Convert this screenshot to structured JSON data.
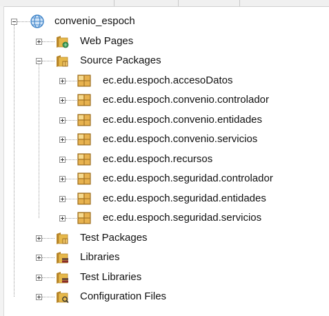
{
  "project": {
    "name": "convenio_espoch",
    "expanded": true
  },
  "nodes": [
    {
      "label": "Web Pages",
      "icon": "web-pages-folder-icon",
      "expanded": false
    },
    {
      "label": "Source Packages",
      "icon": "source-packages-folder-icon",
      "expanded": true,
      "children": [
        {
          "label": "ec.edu.espoch.accesoDatos",
          "icon": "java-package-icon"
        },
        {
          "label": "ec.edu.espoch.convenio.controlador",
          "icon": "java-package-icon"
        },
        {
          "label": "ec.edu.espoch.convenio.entidades",
          "icon": "java-package-icon"
        },
        {
          "label": "ec.edu.espoch.convenio.servicios",
          "icon": "java-package-icon"
        },
        {
          "label": "ec.edu.espoch.recursos",
          "icon": "java-package-icon"
        },
        {
          "label": "ec.edu.espoch.seguridad.controlador",
          "icon": "java-package-icon"
        },
        {
          "label": "ec.edu.espoch.seguridad.entidades",
          "icon": "java-package-icon"
        },
        {
          "label": "ec.edu.espoch.seguridad.servicios",
          "icon": "java-package-icon"
        }
      ]
    },
    {
      "label": "Test Packages",
      "icon": "test-packages-folder-icon",
      "expanded": false
    },
    {
      "label": "Libraries",
      "icon": "libraries-folder-icon",
      "expanded": false
    },
    {
      "label": "Test Libraries",
      "icon": "test-libraries-folder-icon",
      "expanded": false
    },
    {
      "label": "Configuration Files",
      "icon": "configuration-files-folder-icon",
      "expanded": false
    }
  ],
  "colors": {
    "folder": "#e6b84a",
    "folder_dark": "#b8862a",
    "package": "#e7b24f",
    "package_border": "#9a6b1d",
    "globe": "#3f84c8"
  }
}
